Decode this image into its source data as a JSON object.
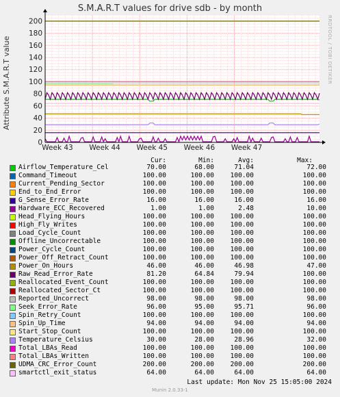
{
  "title": "S.M.A.R.T values for drive sdb - by month",
  "side_text": "RRDTOOL / TOBI OETIKER",
  "ylabel": "Attribute S.M.A.R.T value",
  "columns": {
    "cur": "Cur:",
    "min": "Min:",
    "avg": "Avg:",
    "max": "Max:"
  },
  "last_update": "Last update:  Mon Nov 25 15:05:00 2024",
  "munin": "Munin 2.0.33-1",
  "chart_data": {
    "type": "line",
    "title": "S.M.A.R.T values for drive sdb - by month",
    "ylabel": "Attribute S.M.A.R.T value",
    "ylim": [
      0,
      210
    ],
    "yticks": [
      0,
      20,
      40,
      60,
      80,
      100,
      120,
      140,
      160,
      180,
      200
    ],
    "xtick_labels": [
      "Week 43",
      "Week 44",
      "Week 45",
      "Week 46",
      "Week 47"
    ],
    "grid": true,
    "series": [
      {
        "name": "Airflow_Temperature_Cel",
        "color": "#00cc00",
        "cur": "70.00",
        "min": "68.00",
        "avg": "71.04",
        "max": "72.00"
      },
      {
        "name": "Command_Timeout",
        "color": "#0066b3",
        "cur": "100.00",
        "min": "100.00",
        "avg": "100.00",
        "max": "100.00"
      },
      {
        "name": "Current_Pending_Sector",
        "color": "#ff8000",
        "cur": "100.00",
        "min": "100.00",
        "avg": "100.00",
        "max": "100.00"
      },
      {
        "name": "End_to_End_Error",
        "color": "#ffcc00",
        "cur": "100.00",
        "min": "100.00",
        "avg": "100.00",
        "max": "100.00"
      },
      {
        "name": "G_Sense_Error_Rate",
        "color": "#330099",
        "cur": "16.00",
        "min": "16.00",
        "avg": "16.00",
        "max": "16.00"
      },
      {
        "name": "Hardware_ECC_Recovered",
        "color": "#990099",
        "cur": "1.00",
        "min": "1.00",
        "avg": "2.48",
        "max": "10.00"
      },
      {
        "name": "Head_Flying_Hours",
        "color": "#ccff00",
        "cur": "100.00",
        "min": "100.00",
        "avg": "100.00",
        "max": "100.00"
      },
      {
        "name": "High_Fly_Writes",
        "color": "#ff0000",
        "cur": "100.00",
        "min": "100.00",
        "avg": "100.00",
        "max": "100.00"
      },
      {
        "name": "Load_Cycle_Count",
        "color": "#808080",
        "cur": "100.00",
        "min": "100.00",
        "avg": "100.00",
        "max": "100.00"
      },
      {
        "name": "Offline_Uncorrectable",
        "color": "#008f00",
        "cur": "100.00",
        "min": "100.00",
        "avg": "100.00",
        "max": "100.00"
      },
      {
        "name": "Power_Cycle_Count",
        "color": "#00487d",
        "cur": "100.00",
        "min": "100.00",
        "avg": "100.00",
        "max": "100.00"
      },
      {
        "name": "Power_Off_Retract_Count",
        "color": "#b35a00",
        "cur": "100.00",
        "min": "100.00",
        "avg": "100.00",
        "max": "100.00"
      },
      {
        "name": "Power_On_Hours",
        "color": "#b38f00",
        "cur": "46.00",
        "min": "46.00",
        "avg": "46.98",
        "max": "47.00"
      },
      {
        "name": "Raw_Read_Error_Rate",
        "color": "#6b006b",
        "cur": "81.20",
        "min": "64.84",
        "avg": "79.94",
        "max": "100.00"
      },
      {
        "name": "Reallocated_Event_Count",
        "color": "#8fb300",
        "cur": "100.00",
        "min": "100.00",
        "avg": "100.00",
        "max": "100.00"
      },
      {
        "name": "Reallocated_Sector_Ct",
        "color": "#b30000",
        "cur": "100.00",
        "min": "100.00",
        "avg": "100.00",
        "max": "100.00"
      },
      {
        "name": "Reported_Uncorrect",
        "color": "#bebebe",
        "cur": "98.00",
        "min": "98.00",
        "avg": "98.00",
        "max": "98.00"
      },
      {
        "name": "Seek_Error_Rate",
        "color": "#80ff80",
        "cur": "96.00",
        "min": "95.00",
        "avg": "95.71",
        "max": "96.00"
      },
      {
        "name": "Spin_Retry_Count",
        "color": "#80c9ff",
        "cur": "100.00",
        "min": "100.00",
        "avg": "100.00",
        "max": "100.00"
      },
      {
        "name": "Spin_Up_Time",
        "color": "#ffc080",
        "cur": "94.00",
        "min": "94.00",
        "avg": "94.00",
        "max": "94.00"
      },
      {
        "name": "Start_Stop_Count",
        "color": "#ffe680",
        "cur": "100.00",
        "min": "100.00",
        "avg": "100.00",
        "max": "100.00"
      },
      {
        "name": "Temperature_Celsius",
        "color": "#aa80ff",
        "cur": "30.00",
        "min": "28.00",
        "avg": "28.96",
        "max": "32.00"
      },
      {
        "name": "Total_LBAs_Read",
        "color": "#ee00cc",
        "cur": "100.00",
        "min": "100.00",
        "avg": "100.00",
        "max": "100.00"
      },
      {
        "name": "Total_LBAs_Written",
        "color": "#ff8080",
        "cur": "100.00",
        "min": "100.00",
        "avg": "100.00",
        "max": "100.00"
      },
      {
        "name": "UDMA_CRC_Error_Count",
        "color": "#666600",
        "cur": "200.00",
        "min": "200.00",
        "avg": "200.00",
        "max": "200.00"
      },
      {
        "name": "smartctl_exit_status",
        "color": "#ffbfff",
        "cur": "64.00",
        "min": "64.00",
        "avg": "64.00",
        "max": "64.00"
      }
    ]
  }
}
